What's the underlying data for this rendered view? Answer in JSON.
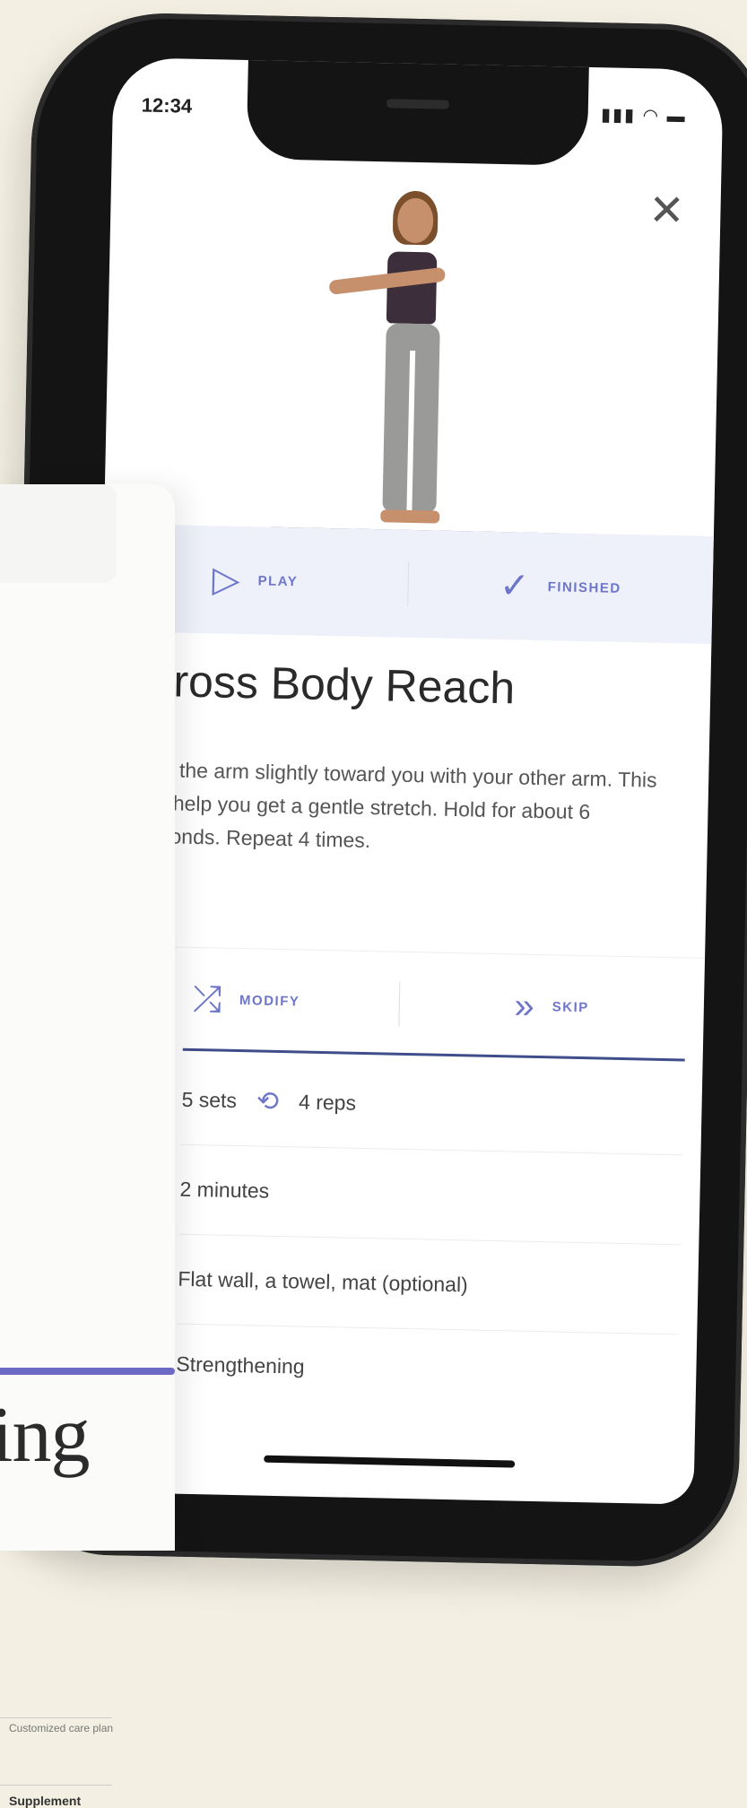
{
  "status": {
    "time": "12:34",
    "icons": "signal wifi battery"
  },
  "exercise": {
    "title": "Cross Body Reach",
    "description": "Pull the arm slightly toward you with your other arm. This will help you get a gentle stretch. Hold for about 6 seconds. Repeat 4 times."
  },
  "actions_top": {
    "play": "PLAY",
    "finished": "FINISHED"
  },
  "actions_bottom": {
    "modify": "MODIFY",
    "skip": "SKIP"
  },
  "details": {
    "sets": "5 sets",
    "reps": "4 reps",
    "duration": "2 minutes",
    "equipment": "Flat wall, a towel, mat (optional)",
    "category": "Strengthening"
  },
  "card": {
    "word": "ing",
    "text": "Customized care plan",
    "supplement": "Supplement"
  },
  "colors": {
    "accent": "#6e76c9",
    "divider": "#3f4e8a",
    "card_accent": "#6d6ac6"
  }
}
